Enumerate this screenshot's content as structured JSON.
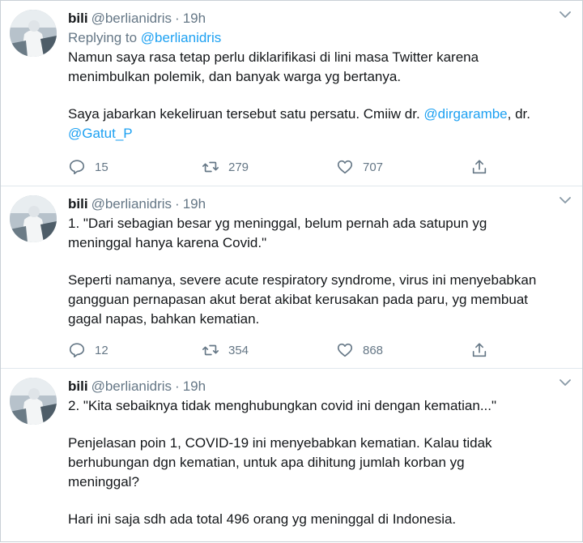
{
  "tweets": [
    {
      "name": "bili",
      "handle": "@berlianidris",
      "sep": "·",
      "time": "19h",
      "reply_prefix": "Replying to ",
      "reply_handle": "@berlianidris",
      "p1_l1": "Namun saya rasa tetap perlu diklarifikasi di lini masa Twitter karena",
      "p1_l2": "menimbulkan polemik, dan banyak warga yg bertanya.",
      "p2_l1_text": "Saya jabarkan kekeliruan tersebut satu persatu. Cmiiw dr. ",
      "p2_l1_mention": "@dirgarambe",
      "p2_l1_tail": ", dr.",
      "p2_l2_mention": "@Gatut_P",
      "replies": "15",
      "retweets": "279",
      "likes": "707"
    },
    {
      "name": "bili",
      "handle": "@berlianidris",
      "sep": "·",
      "time": "19h",
      "p1_l1": "1. \"Dari sebagian besar yg meninggal, belum pernah ada satupun yg",
      "p1_l2": "meninggal hanya karena Covid.\"",
      "p2_l1": "Seperti namanya, severe acute respiratory syndrome, virus ini menyebabkan",
      "p2_l2": "gangguan pernapasan akut berat akibat kerusakan pada paru, yg membuat",
      "p2_l3": "gagal napas, bahkan kematian.",
      "replies": "12",
      "retweets": "354",
      "likes": "868"
    },
    {
      "name": "bili",
      "handle": "@berlianidris",
      "sep": "·",
      "time": "19h",
      "p1_l1": "2. \"Kita sebaiknya tidak menghubungkan covid ini dengan kematian...\"",
      "p2_l1": "Penjelasan poin 1, COVID-19 ini menyebabkan kematian. Kalau tidak",
      "p2_l2": "berhubungan dgn kematian, untuk apa dihitung jumlah korban yg",
      "p2_l3": "meninggal?",
      "p3_l1": "Hari ini saja sdh ada total 496 orang yg meninggal di Indonesia."
    }
  ],
  "icons": {
    "reply": "reply-icon",
    "retweet": "retweet-icon",
    "like": "heart-icon",
    "share": "share-icon",
    "caret": "chevron-down-icon"
  },
  "colors": {
    "link": "#1da1f2",
    "muted": "#657786",
    "text": "#14171a"
  }
}
